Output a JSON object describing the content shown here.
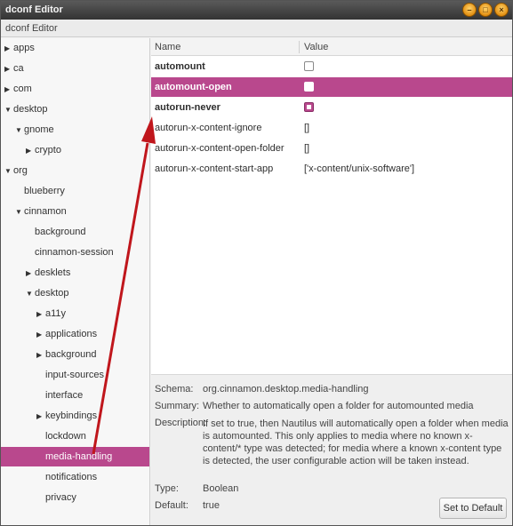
{
  "window": {
    "title": "dconf Editor",
    "buttons": [
      "minimize",
      "maximize",
      "close"
    ]
  },
  "menubar": {
    "label": "dconf Editor"
  },
  "tree": {
    "items": [
      {
        "label": "apps",
        "expander": "collapsed",
        "depth": 0
      },
      {
        "label": "ca",
        "expander": "collapsed",
        "depth": 0
      },
      {
        "label": "com",
        "expander": "collapsed",
        "depth": 0
      },
      {
        "label": "desktop",
        "expander": "expanded",
        "depth": 0
      },
      {
        "label": "gnome",
        "expander": "expanded",
        "depth": 1
      },
      {
        "label": "crypto",
        "expander": "collapsed",
        "depth": 2
      },
      {
        "label": "org",
        "expander": "expanded",
        "depth": 0
      },
      {
        "label": "blueberry",
        "expander": "none",
        "depth": 1
      },
      {
        "label": "cinnamon",
        "expander": "expanded",
        "depth": 1
      },
      {
        "label": "background",
        "expander": "none",
        "depth": 2
      },
      {
        "label": "cinnamon-session",
        "expander": "none",
        "depth": 2
      },
      {
        "label": "desklets",
        "expander": "collapsed",
        "depth": 2
      },
      {
        "label": "desktop",
        "expander": "expanded",
        "depth": 2
      },
      {
        "label": "a11y",
        "expander": "collapsed",
        "depth": 3
      },
      {
        "label": "applications",
        "expander": "collapsed",
        "depth": 3
      },
      {
        "label": "background",
        "expander": "collapsed",
        "depth": 3
      },
      {
        "label": "input-sources",
        "expander": "none",
        "depth": 3
      },
      {
        "label": "interface",
        "expander": "none",
        "depth": 3
      },
      {
        "label": "keybindings",
        "expander": "collapsed",
        "depth": 3
      },
      {
        "label": "lockdown",
        "expander": "none",
        "depth": 3
      },
      {
        "label": "media-handling",
        "expander": "none",
        "depth": 3,
        "selected": true
      },
      {
        "label": "notifications",
        "expander": "none",
        "depth": 3
      },
      {
        "label": "privacy",
        "expander": "none",
        "depth": 3
      }
    ]
  },
  "keys": {
    "columns": {
      "name": "Name",
      "value": "Value"
    },
    "rows": [
      {
        "name": "automount",
        "bold": true,
        "type": "checkbox",
        "checked": false
      },
      {
        "name": "automount-open",
        "bold": true,
        "type": "checkbox",
        "checked": true,
        "selected": true
      },
      {
        "name": "autorun-never",
        "bold": true,
        "type": "checkbox",
        "checked": true
      },
      {
        "name": "autorun-x-content-ignore",
        "bold": false,
        "type": "text",
        "value": "[]"
      },
      {
        "name": "autorun-x-content-open-folder",
        "bold": false,
        "type": "text",
        "value": "[]"
      },
      {
        "name": "autorun-x-content-start-app",
        "bold": false,
        "type": "text",
        "value": "['x-content/unix-software']"
      }
    ]
  },
  "details": {
    "schema_label": "Schema:",
    "schema": "org.cinnamon.desktop.media-handling",
    "summary_label": "Summary:",
    "summary": "Whether to automatically open a folder for automounted media",
    "description_label": "Description:",
    "description": "If set to true, then Nautilus will automatically open a folder when media is automounted. This only applies to media where no known x-content/* type was detected; for media where a known x-content type is detected, the user configurable action will be taken instead.",
    "type_label": "Type:",
    "type": "Boolean",
    "default_label": "Default:",
    "default": "true",
    "reset_button": "Set to Default"
  },
  "colors": {
    "selection": "#b9488d",
    "titlebar": "#3f3f3f",
    "arrow": "#c0161c"
  }
}
